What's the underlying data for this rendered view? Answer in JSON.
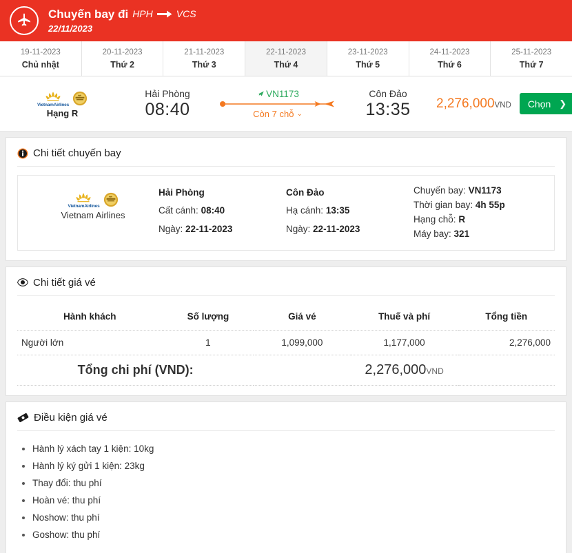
{
  "theme": {
    "red": "#ea3223",
    "orange": "#f47920",
    "green": "#2eaa5e",
    "button_green": "#00a651",
    "page_bg": "#eeeeee"
  },
  "header": {
    "title": "Chuyến bay đi",
    "origin_code": "HPH",
    "dest_code": "VCS",
    "date": "22/11/2023",
    "plane_icon": "plane-icon",
    "arrow_icon": "arrow-right-icon"
  },
  "date_tabs": [
    {
      "date": "19-11-2023",
      "day": "Chủ nhật",
      "active": false
    },
    {
      "date": "20-11-2023",
      "day": "Thứ 2",
      "active": false
    },
    {
      "date": "21-11-2023",
      "day": "Thứ 3",
      "active": false
    },
    {
      "date": "22-11-2023",
      "day": "Thứ 4",
      "active": true
    },
    {
      "date": "23-11-2023",
      "day": "Thứ 5",
      "active": false
    },
    {
      "date": "24-11-2023",
      "day": "Thứ 6",
      "active": false
    },
    {
      "date": "25-11-2023",
      "day": "Thứ 7",
      "active": false
    }
  ],
  "flight_row": {
    "airline_logo": "vietnam-airlines-logo",
    "airline_short": "VietnamAirlines",
    "award_badge": "skytrax-award-badge",
    "class_label": "Hạng R",
    "depart_city": "Hải Phòng",
    "depart_time": "08:40",
    "flight_number": "VN1173",
    "seats_left": "Còn 7 chỗ",
    "seats_chevron": "⌄",
    "arrive_city": "Côn Đảo",
    "arrive_time": "13:35",
    "price": "2,276,000",
    "currency": "VND",
    "choose_label": "Chọn",
    "choose_chevron": "❯"
  },
  "flight_detail": {
    "section_title": "Chi tiết chuyến bay",
    "section_icon": "info-icon",
    "airline_name": "Vietnam Airlines",
    "depart": {
      "city": "Hải Phòng",
      "time_label": "Cất cánh:",
      "time": "08:40",
      "date_label": "Ngày:",
      "date": "22-11-2023"
    },
    "arrive": {
      "city": "Côn Đảo",
      "time_label": "Hạ cánh:",
      "time": "13:35",
      "date_label": "Ngày:",
      "date": "22-11-2023"
    },
    "meta": {
      "flight_label": "Chuyến bay:",
      "flight_value": "VN1173",
      "duration_label": "Thời gian bay:",
      "duration_value": "4h 55p",
      "class_label": "Hạng chỗ:",
      "class_value": "R",
      "aircraft_label": "Máy bay:",
      "aircraft_value": "321"
    }
  },
  "fare_detail": {
    "section_title": "Chi tiết giá vé",
    "section_icon": "eye-icon",
    "columns": [
      "Hành khách",
      "Số lượng",
      "Giá vé",
      "Thuế và phí",
      "Tổng tiền"
    ],
    "rows": [
      [
        "Người lớn",
        "1",
        "1,099,000",
        "1,177,000",
        "2,276,000"
      ]
    ],
    "total_label": "Tổng chi phí (VND):",
    "total_value": "2,276,000",
    "total_currency": "VND"
  },
  "fare_conditions": {
    "section_title": "Điều kiện giá vé",
    "section_icon": "ticket-icon",
    "items": [
      "Hành lý xách tay 1 kiện: 10kg",
      "Hành lý ký gửi 1 kiện: 23kg",
      "Thay đổi: thu phí",
      "Hoàn vé: thu phí",
      "Noshow: thu phí",
      "Goshow: thu phí"
    ]
  }
}
